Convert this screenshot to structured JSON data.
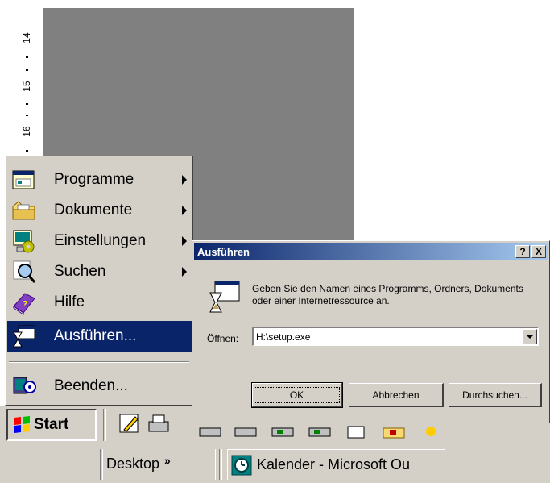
{
  "ruler": {
    "marks": [
      "14",
      "15",
      "16"
    ]
  },
  "start_menu": {
    "items": [
      {
        "label": "Programme",
        "icon": "programs-folder-icon",
        "submenu": true
      },
      {
        "label": "Dokumente",
        "icon": "documents-folder-icon",
        "submenu": true
      },
      {
        "label": "Einstellungen",
        "icon": "settings-icon",
        "submenu": true
      },
      {
        "label": "Suchen",
        "icon": "search-icon",
        "submenu": true
      },
      {
        "label": "Hilfe",
        "icon": "help-book-icon",
        "submenu": false
      },
      {
        "label": "Ausführen...",
        "icon": "run-icon",
        "submenu": false,
        "selected": true
      },
      {
        "label": "Beenden...",
        "icon": "shutdown-icon",
        "submenu": false
      }
    ]
  },
  "taskbar": {
    "start_label": "Start",
    "desktop_label": "Desktop",
    "chevron": "»",
    "task_label": "Kalender - Microsoft Ou"
  },
  "dialog": {
    "title": "Ausführen",
    "help_button": "?",
    "close_button": "X",
    "message": "Geben Sie den Namen eines Programms, Ordners, Dokuments oder einer Internetressource an.",
    "open_label": "Öffnen:",
    "open_value": "H:\\setup.exe",
    "buttons": {
      "ok": "OK",
      "cancel": "Abbrechen",
      "browse": "Durchsuchen..."
    }
  },
  "colors": {
    "face": "#d4d0c8",
    "selection": "#0a246a",
    "title_start": "#0a246a",
    "title_end": "#a6caf0",
    "workspace": "#808080"
  }
}
